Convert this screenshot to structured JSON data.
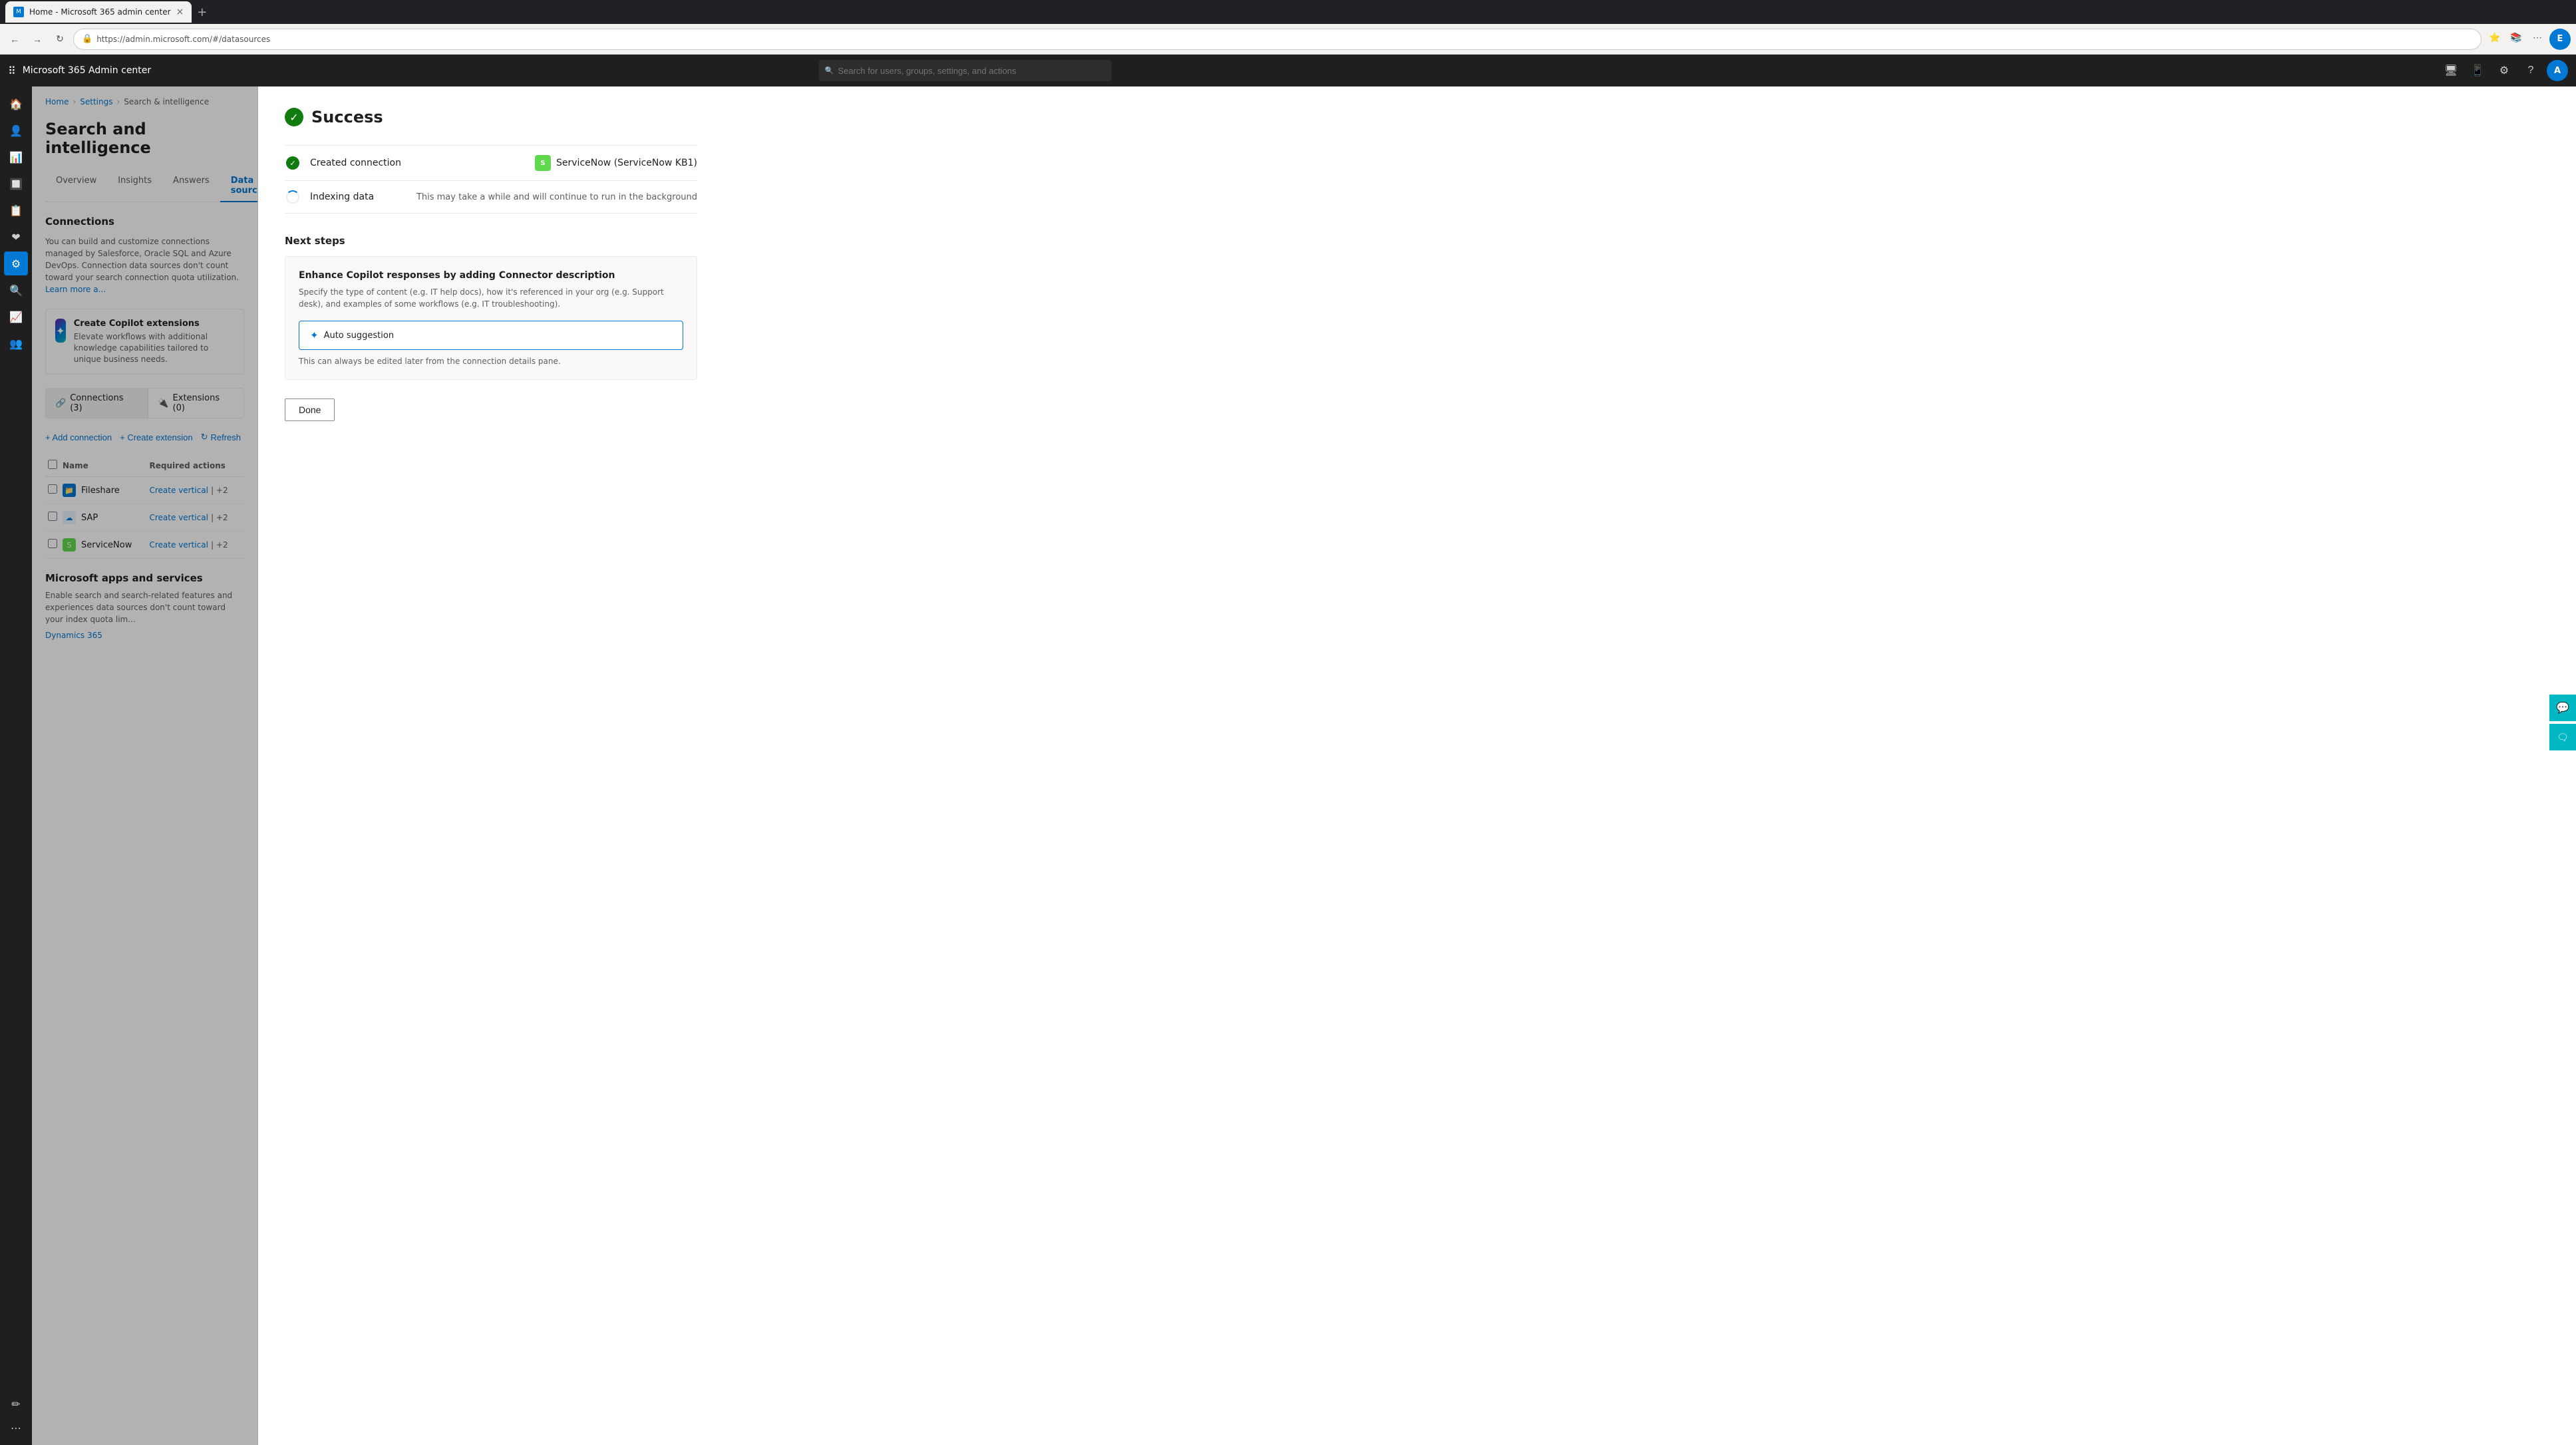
{
  "browser": {
    "tab_label": "Home - Microsoft 365 admin center",
    "close_label": "×",
    "new_tab_label": "+",
    "address": "https://admin.microsoft.com/#/datasources",
    "back_label": "←",
    "forward_label": "→",
    "refresh_label": "↻"
  },
  "topbar": {
    "app_name": "Microsoft 365 Admin center",
    "search_placeholder": "Search for users, groups, settings, and actions"
  },
  "breadcrumb": {
    "home": "Home",
    "settings": "Settings",
    "search_intelligence": "Search & intelligence"
  },
  "page": {
    "title": "Search and intelligence",
    "tabs": [
      {
        "label": "Overview",
        "active": false
      },
      {
        "label": "Insights",
        "active": false
      },
      {
        "label": "Answers",
        "active": false
      },
      {
        "label": "Data sources",
        "active": true
      }
    ]
  },
  "connections": {
    "section_title": "Connections",
    "description": "You can build and customize connections managed by Salesforce, Oracle SQL and Azure DevOps. Connection data sources don't count toward your search connection quota utilization.",
    "learn_more_link": "Learn more a...",
    "copilot_banner": {
      "title": "Create Copilot extensions",
      "description": "Elevate workflows with additional knowledge capabilities tailored to unique business needs."
    },
    "sub_tabs": [
      {
        "label": "Connections (3)",
        "active": true
      },
      {
        "label": "Extensions (0)",
        "active": false
      }
    ],
    "toolbar": {
      "add_connection": "+ Add connection",
      "create_extension": "+ Create extension",
      "refresh": "Refresh"
    },
    "table": {
      "columns": [
        "Name",
        "Required actions"
      ],
      "rows": [
        {
          "name": "Fileshare",
          "icon_color": "#0078d4",
          "icon_text": "📁",
          "action": "Create vertical",
          "action_extra": "| +2"
        },
        {
          "name": "SAP",
          "icon_color": "#00aaff",
          "icon_text": "☁",
          "action": "Create vertical",
          "action_extra": "| +2"
        },
        {
          "name": "ServiceNow",
          "icon_color": "#62d84e",
          "icon_text": "🟢",
          "action": "Create vertical",
          "action_extra": "| +2"
        }
      ]
    }
  },
  "ms_apps": {
    "title": "Microsoft apps and services",
    "description": "Enable search and search-related features and experiences data sources don't count toward your index quota lim...",
    "dynamics_link": "Dynamics 365"
  },
  "success_panel": {
    "title": "Success",
    "steps": [
      {
        "label": "Created connection",
        "type": "check",
        "value": "ServiceNow (ServiceNow KB1)"
      },
      {
        "label": "Indexing data",
        "type": "spinner",
        "value": "This may take a while and will continue to run in the background"
      }
    ],
    "next_steps_label": "Next steps",
    "enhance_card": {
      "title": "Enhance Copilot responses by adding Connector description",
      "description": "Specify the type of content (e.g. IT help docs), how it's referenced in your org (e.g. Support desk), and examples of some workflows (e.g. IT troubleshooting).",
      "auto_suggestion_label": "Auto suggestion",
      "edit_note": "This can always be edited later from the connection details pane."
    },
    "done_btn": "Done"
  }
}
